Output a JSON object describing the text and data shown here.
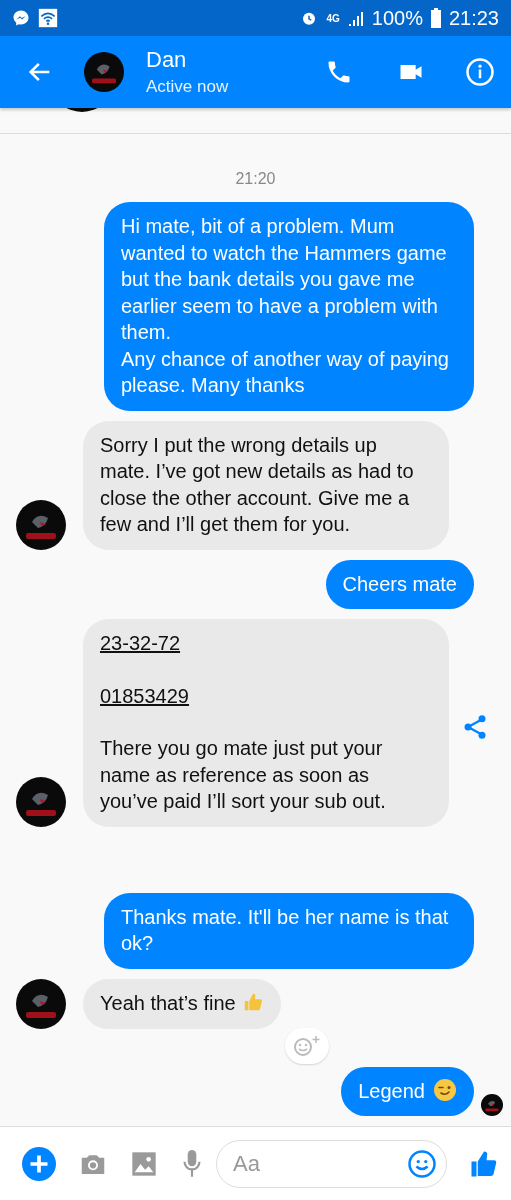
{
  "status_bar": {
    "network": "4G",
    "battery": "100%",
    "time": "21:23"
  },
  "header": {
    "name": "Dan",
    "status": "Active now"
  },
  "timestamp": "21:20",
  "messages": [
    {
      "kind": "outgoing",
      "lines": [
        {
          "kind": "text",
          "text": "Hi mate, bit of a problem. Mum wanted to watch the Hammers game but the bank details you gave me earlier seem to have a problem with them.\nAny chance of another way of paying please. Many thanks"
        }
      ]
    },
    {
      "kind": "incoming",
      "avatar": true,
      "lines": [
        {
          "kind": "text",
          "text": "Sorry I put the wrong details up mate. I’ve got new details as had to close the other account. Give me a few and I’ll get them for you."
        }
      ]
    },
    {
      "kind": "outgoing",
      "lines": [
        {
          "kind": "text",
          "text": "Cheers mate"
        }
      ]
    },
    {
      "kind": "incoming",
      "avatar": true,
      "share": true,
      "lines": [
        {
          "kind": "link",
          "text": "23-32-72"
        },
        {
          "kind": "link",
          "text": "01853429"
        },
        {
          "kind": "text",
          "text": "There you go mate just put your name as reference as soon as you’ve paid I’ll sort your sub out."
        }
      ]
    },
    {
      "kind": "outgoing",
      "lines": [
        {
          "kind": "text",
          "text": "Thanks mate. It'll be her name is that ok?"
        }
      ]
    },
    {
      "kind": "incoming",
      "avatar": true,
      "react": true,
      "lines": [
        {
          "kind": "text",
          "text": "Yeah that’s fine"
        },
        {
          "kind": "thumbs-up"
        }
      ]
    },
    {
      "kind": "outgoing",
      "seen": true,
      "lines": [
        {
          "kind": "text",
          "text": "Legend"
        },
        {
          "kind": "wink"
        }
      ]
    }
  ],
  "composer": {
    "placeholder": "Aa"
  }
}
